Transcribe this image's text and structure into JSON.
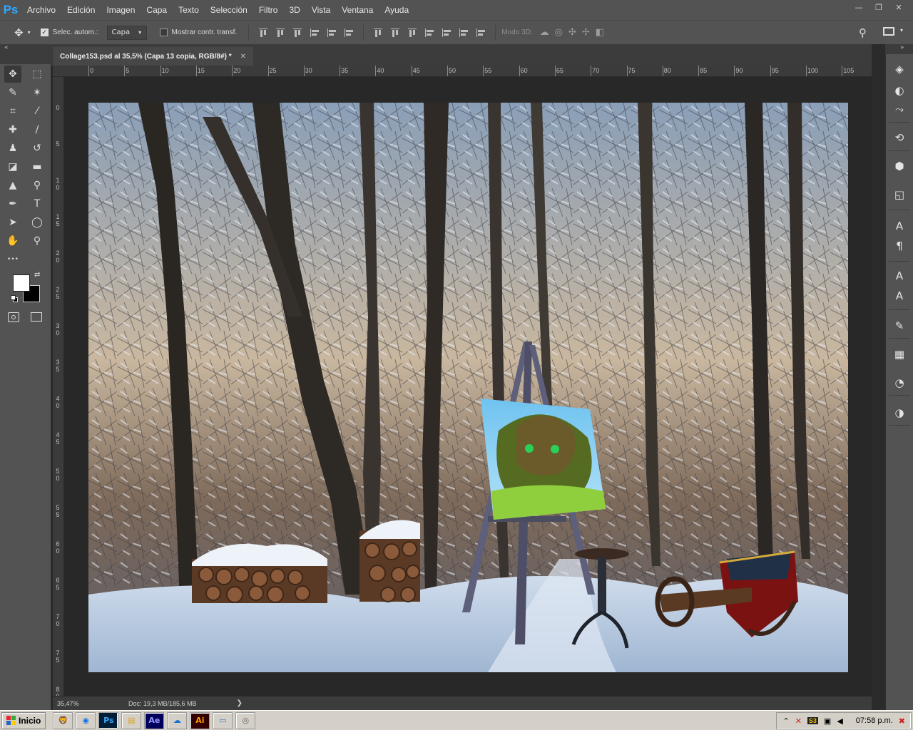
{
  "app": {
    "logo": "Ps",
    "menu": [
      "Archivo",
      "Edición",
      "Imagen",
      "Capa",
      "Texto",
      "Selección",
      "Filtro",
      "3D",
      "Vista",
      "Ventana",
      "Ayuda"
    ],
    "window_controls": {
      "minimize": "—",
      "restore": "❐",
      "close": "✕"
    }
  },
  "options": {
    "auto_select_label": "Selec. autom.:",
    "auto_select_checked": true,
    "layer_select_value": "Capa",
    "show_transform_label": "Mostrar contr. transf.",
    "show_transform_checked": false,
    "mode_3d_label": "Modo 3D:"
  },
  "document": {
    "tab_title": "Collage153.psd al 35,5% (Capa 13 copia, RGB/8#) *",
    "zoom": "35,47%",
    "doc_info": "Doc: 19,3 MB/185,6 MB"
  },
  "rulers": {
    "top": [
      "0",
      "5",
      "10",
      "15",
      "20",
      "25",
      "30",
      "35",
      "40",
      "45",
      "50",
      "55",
      "60",
      "65",
      "70",
      "75",
      "80",
      "85",
      "90",
      "95",
      "100",
      "105"
    ],
    "left": [
      "0",
      "5",
      "1\n0",
      "1\n5",
      "2\n0",
      "2\n5",
      "3\n0",
      "3\n5",
      "4\n0",
      "4\n5",
      "5\n0",
      "5\n5",
      "6\n0",
      "6\n5",
      "7\n0",
      "7\n5",
      "8\n0"
    ]
  },
  "tools": [
    {
      "name": "move-tool-icon",
      "glyph": "✥"
    },
    {
      "name": "marquee-tool-icon",
      "glyph": "⬚"
    },
    {
      "name": "lasso-tool-icon",
      "glyph": "✎"
    },
    {
      "name": "magic-wand-tool-icon",
      "glyph": "✶"
    },
    {
      "name": "crop-tool-icon",
      "glyph": "⌗"
    },
    {
      "name": "eyedropper-tool-icon",
      "glyph": "⁄"
    },
    {
      "name": "healing-brush-tool-icon",
      "glyph": "✚"
    },
    {
      "name": "brush-tool-icon",
      "glyph": "∕"
    },
    {
      "name": "stamp-tool-icon",
      "glyph": "♟"
    },
    {
      "name": "history-brush-tool-icon",
      "glyph": "↺"
    },
    {
      "name": "eraser-tool-icon",
      "glyph": "◪"
    },
    {
      "name": "gradient-tool-icon",
      "glyph": "▬"
    },
    {
      "name": "blur-tool-icon",
      "glyph": "▲"
    },
    {
      "name": "dodge-tool-icon",
      "glyph": "⚲"
    },
    {
      "name": "pen-tool-icon",
      "glyph": "✒"
    },
    {
      "name": "type-tool-icon",
      "glyph": "T"
    },
    {
      "name": "path-selection-tool-icon",
      "glyph": "➤"
    },
    {
      "name": "ellipse-tool-icon",
      "glyph": "◯"
    },
    {
      "name": "hand-tool-icon",
      "glyph": "✋"
    },
    {
      "name": "zoom-tool-icon",
      "glyph": "⚲"
    },
    {
      "name": "more-tools-icon",
      "glyph": "•••"
    }
  ],
  "dock_icons": [
    "layers-icon",
    "channels-icon",
    "paths-icon",
    "history-icon",
    "3d-icon",
    "properties-icon",
    "character-icon",
    "paragraph-icon",
    "character-styles-icon",
    "paragraph-styles-icon",
    "brush-presets-icon",
    "grid-icon",
    "swatches-icon",
    "adjustments-icon"
  ],
  "taskbar": {
    "start_label": "Inicio",
    "apps": [
      "brave-icon",
      "chrome-icon",
      "photoshop-icon",
      "explorer-icon",
      "after-effects-icon",
      "onedrive-icon",
      "illustrator-icon",
      "notepad-icon",
      "viewer-icon"
    ],
    "clock": "07:58 p.m."
  },
  "colors": {
    "accent": "#31a8ff",
    "panel": "#535353",
    "workspace": "#282828"
  }
}
